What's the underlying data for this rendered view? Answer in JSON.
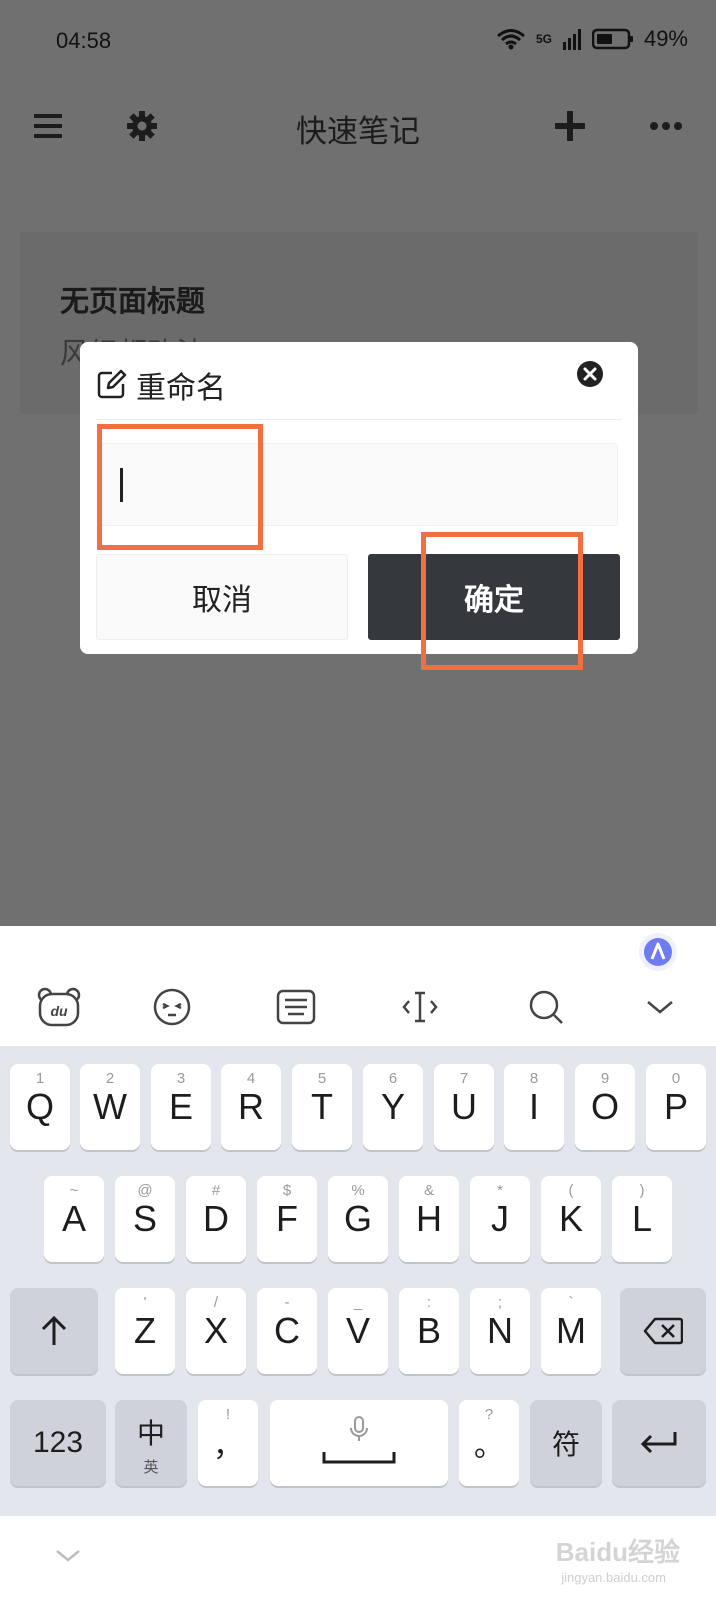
{
  "status_bar": {
    "time": "04:58",
    "network": "5G",
    "battery": "49%"
  },
  "top_bar": {
    "title": "快速笔记"
  },
  "note": {
    "title": "无页面标题",
    "snippet": "风织都改法"
  },
  "rename_dialog": {
    "title": "重命名",
    "input_value": "",
    "cancel_label": "取消",
    "confirm_label": "确定"
  },
  "keyboard": {
    "row1": [
      {
        "key": "Q",
        "sub": "1"
      },
      {
        "key": "W",
        "sub": "2"
      },
      {
        "key": "E",
        "sub": "3"
      },
      {
        "key": "R",
        "sub": "4"
      },
      {
        "key": "T",
        "sub": "5"
      },
      {
        "key": "Y",
        "sub": "6"
      },
      {
        "key": "U",
        "sub": "7"
      },
      {
        "key": "I",
        "sub": "8"
      },
      {
        "key": "O",
        "sub": "9"
      },
      {
        "key": "P",
        "sub": "0"
      }
    ],
    "row2": [
      {
        "key": "A",
        "sub": "~"
      },
      {
        "key": "S",
        "sub": "@"
      },
      {
        "key": "D",
        "sub": "#"
      },
      {
        "key": "F",
        "sub": "$"
      },
      {
        "key": "G",
        "sub": "%"
      },
      {
        "key": "H",
        "sub": "&"
      },
      {
        "key": "J",
        "sub": "*"
      },
      {
        "key": "K",
        "sub": "("
      },
      {
        "key": "L",
        "sub": ")"
      }
    ],
    "row3": [
      {
        "key": "Z",
        "sub": "'"
      },
      {
        "key": "X",
        "sub": "/"
      },
      {
        "key": "C",
        "sub": "-"
      },
      {
        "key": "V",
        "sub": "_"
      },
      {
        "key": "B",
        "sub": ":"
      },
      {
        "key": "N",
        "sub": ";"
      },
      {
        "key": "M",
        "sub": "`"
      }
    ],
    "num_label": "123",
    "lang_label": "中",
    "lang_sub": "英",
    "comma_label": "，",
    "comma_sub": "!",
    "period_label": "。",
    "period_sub": "?",
    "symbol_label": "符"
  },
  "watermark": {
    "text": "Baidu经验",
    "sub": "jingyan.baidu.com"
  },
  "colors": {
    "highlight": "#f26f42",
    "confirm_bg": "#35383d",
    "dim_overlay": "#707070"
  }
}
